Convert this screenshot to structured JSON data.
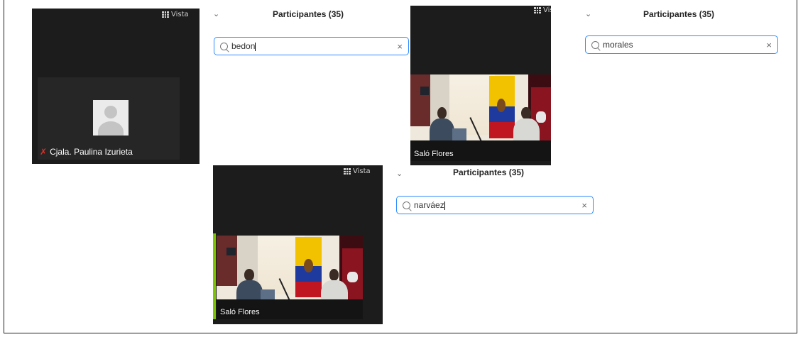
{
  "panels": [
    {
      "view_label": "Vista",
      "participants_title": "Participantes (35)",
      "search_query": "bedon",
      "tile_name": "Cjala. Paulina Izurieta",
      "tile_kind": "avatar",
      "mic_muted": true
    },
    {
      "view_label": "Vista",
      "participants_title": "Participantes (35)",
      "search_query": "morales",
      "tile_name": "Saló Flores",
      "tile_kind": "video"
    },
    {
      "view_label": "Vista",
      "participants_title": "Participantes (35)",
      "search_query": "narváez",
      "tile_name": "Saló Flores",
      "tile_kind": "video",
      "active_speaker": true
    }
  ],
  "colors": {
    "search_border": "#2d8cff",
    "meeting_bg": "#1c1c1c",
    "muted_mic": "#e0302a",
    "active_speaker": "#7dc400"
  },
  "icons": {
    "view": "grid-icon",
    "chevron": "chevron-down-icon",
    "search": "search-icon",
    "clear": "close-icon",
    "mic": "mic-off-icon"
  }
}
